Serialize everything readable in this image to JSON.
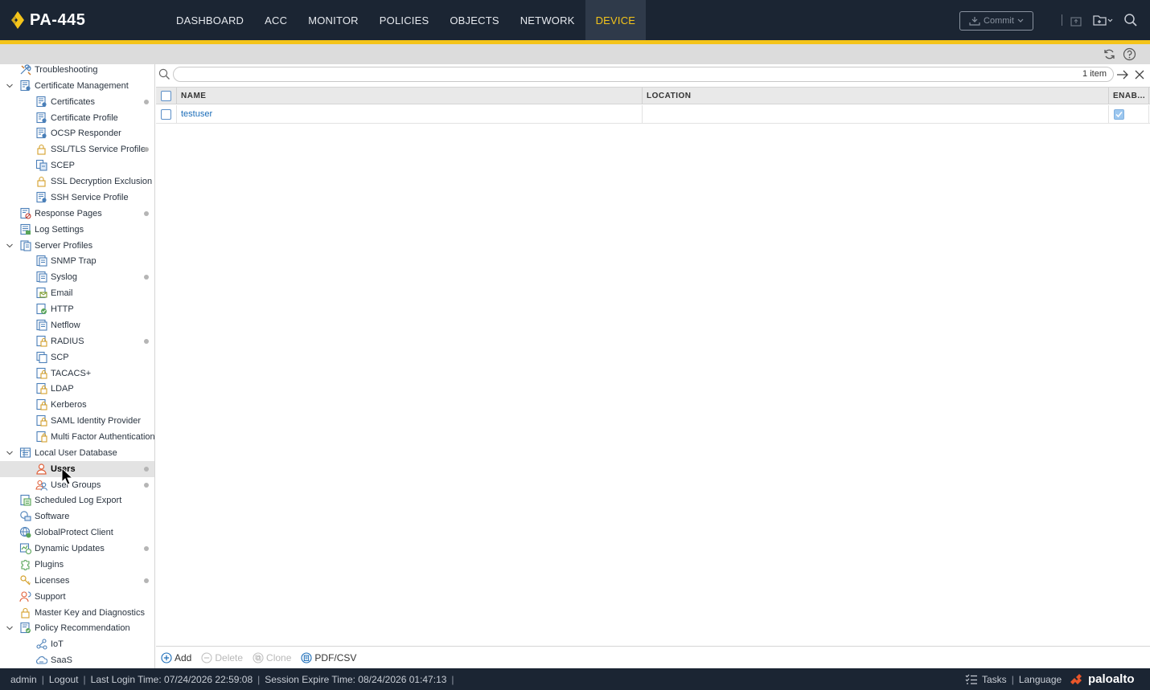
{
  "app": {
    "device_name": "PA-445",
    "accent_color": "#f4c41a",
    "nav_bg": "#1b2533"
  },
  "nav": {
    "tabs": [
      {
        "label": "DASHBOARD"
      },
      {
        "label": "ACC"
      },
      {
        "label": "MONITOR"
      },
      {
        "label": "POLICIES"
      },
      {
        "label": "OBJECTS"
      },
      {
        "label": "NETWORK"
      },
      {
        "label": "DEVICE"
      }
    ],
    "active_tab": "DEVICE",
    "commit_label": "Commit"
  },
  "sidebar": {
    "items": [
      {
        "label": "Troubleshooting",
        "icon": "tools-icon",
        "level": 1,
        "caret": false,
        "dot": false
      },
      {
        "label": "Certificate Management",
        "icon": "certificate-icon",
        "level": 1,
        "caret": true,
        "dot": false
      },
      {
        "label": "Certificates",
        "icon": "certificate-icon",
        "level": 2,
        "caret": false,
        "dot": true
      },
      {
        "label": "Certificate Profile",
        "icon": "certificate-icon",
        "level": 2,
        "caret": false,
        "dot": false
      },
      {
        "label": "OCSP Responder",
        "icon": "certificate-icon",
        "level": 2,
        "caret": false,
        "dot": false
      },
      {
        "label": "SSL/TLS Service Profile",
        "icon": "lock-icon",
        "level": 2,
        "caret": false,
        "dot": true
      },
      {
        "label": "SCEP",
        "icon": "scep-icon",
        "level": 2,
        "caret": false,
        "dot": false
      },
      {
        "label": "SSL Decryption Exclusion",
        "icon": "lock-icon",
        "level": 2,
        "caret": false,
        "dot": false
      },
      {
        "label": "SSH Service Profile",
        "icon": "certificate-icon",
        "level": 2,
        "caret": false,
        "dot": false
      },
      {
        "label": "Response Pages",
        "icon": "response-pages-icon",
        "level": 1,
        "caret": false,
        "dot": true
      },
      {
        "label": "Log Settings",
        "icon": "log-settings-icon",
        "level": 1,
        "caret": false,
        "dot": false
      },
      {
        "label": "Server Profiles",
        "icon": "server-profile-icon",
        "level": 1,
        "caret": true,
        "dot": false
      },
      {
        "label": "SNMP Trap",
        "icon": "document-icon",
        "level": 2,
        "caret": false,
        "dot": false
      },
      {
        "label": "Syslog",
        "icon": "document-icon",
        "level": 2,
        "caret": false,
        "dot": true
      },
      {
        "label": "Email",
        "icon": "email-profile-icon",
        "level": 2,
        "caret": false,
        "dot": false
      },
      {
        "label": "HTTP",
        "icon": "http-profile-icon",
        "level": 2,
        "caret": false,
        "dot": false
      },
      {
        "label": "Netflow",
        "icon": "document-icon",
        "level": 2,
        "caret": false,
        "dot": false
      },
      {
        "label": "RADIUS",
        "icon": "auth-profile-icon",
        "level": 2,
        "caret": false,
        "dot": true
      },
      {
        "label": "SCP",
        "icon": "copy-icon",
        "level": 2,
        "caret": false,
        "dot": false
      },
      {
        "label": "TACACS+",
        "icon": "auth-profile-icon",
        "level": 2,
        "caret": false,
        "dot": false
      },
      {
        "label": "LDAP",
        "icon": "auth-profile-icon",
        "level": 2,
        "caret": false,
        "dot": false
      },
      {
        "label": "Kerberos",
        "icon": "auth-profile-icon",
        "level": 2,
        "caret": false,
        "dot": false
      },
      {
        "label": "SAML Identity Provider",
        "icon": "auth-profile-icon",
        "level": 2,
        "caret": false,
        "dot": false
      },
      {
        "label": "Multi Factor Authentication",
        "icon": "mfa-icon",
        "level": 2,
        "caret": false,
        "dot": false
      },
      {
        "label": "Local User Database",
        "icon": "database-icon",
        "level": 1,
        "caret": true,
        "dot": false
      },
      {
        "label": "Users",
        "icon": "user-icon",
        "level": 2,
        "caret": false,
        "dot": true,
        "selected": true
      },
      {
        "label": "User Groups",
        "icon": "user-group-icon",
        "level": 2,
        "caret": false,
        "dot": true
      },
      {
        "label": "Scheduled Log Export",
        "icon": "scheduled-export-icon",
        "level": 1,
        "caret": false,
        "dot": false
      },
      {
        "label": "Software",
        "icon": "software-icon",
        "level": 1,
        "caret": false,
        "dot": false
      },
      {
        "label": "GlobalProtect Client",
        "icon": "globe-icon",
        "level": 1,
        "caret": false,
        "dot": false
      },
      {
        "label": "Dynamic Updates",
        "icon": "dynamic-updates-icon",
        "level": 1,
        "caret": false,
        "dot": true
      },
      {
        "label": "Plugins",
        "icon": "puzzle-icon",
        "level": 1,
        "caret": false,
        "dot": false
      },
      {
        "label": "Licenses",
        "icon": "key-icon",
        "level": 1,
        "caret": false,
        "dot": true
      },
      {
        "label": "Support",
        "icon": "support-icon",
        "level": 1,
        "caret": false,
        "dot": false
      },
      {
        "label": "Master Key and Diagnostics",
        "icon": "lock-icon",
        "level": 1,
        "caret": false,
        "dot": false
      },
      {
        "label": "Policy Recommendation",
        "icon": "policy-recommendation-icon",
        "level": 1,
        "caret": true,
        "dot": false
      },
      {
        "label": "IoT",
        "icon": "iot-icon",
        "level": 2,
        "caret": false,
        "dot": false
      },
      {
        "label": "SaaS",
        "icon": "saas-icon",
        "level": 2,
        "caret": false,
        "dot": false
      }
    ]
  },
  "main": {
    "filter": {
      "value": "",
      "placeholder": "",
      "count": "1 item"
    },
    "columns": [
      "NAME",
      "LOCATION",
      "ENAB..."
    ],
    "rows": [
      {
        "name": "testuser",
        "location": "",
        "enabled": true
      }
    ],
    "actions": [
      {
        "label": "Add",
        "icon": "add-icon",
        "enabled": true
      },
      {
        "label": "Delete",
        "icon": "delete-icon",
        "enabled": false
      },
      {
        "label": "Clone",
        "icon": "clone-icon",
        "enabled": false
      },
      {
        "label": "PDF/CSV",
        "icon": "pdf-csv-icon",
        "enabled": true
      }
    ]
  },
  "status": {
    "user": "admin",
    "logout": "Logout",
    "last_login": "Last Login Time: 07/24/2026 22:59:08",
    "session_expire": "Session Expire Time: 08/24/2026 01:47:13",
    "tasks": "Tasks",
    "language": "Language",
    "brand": "paloalto"
  }
}
